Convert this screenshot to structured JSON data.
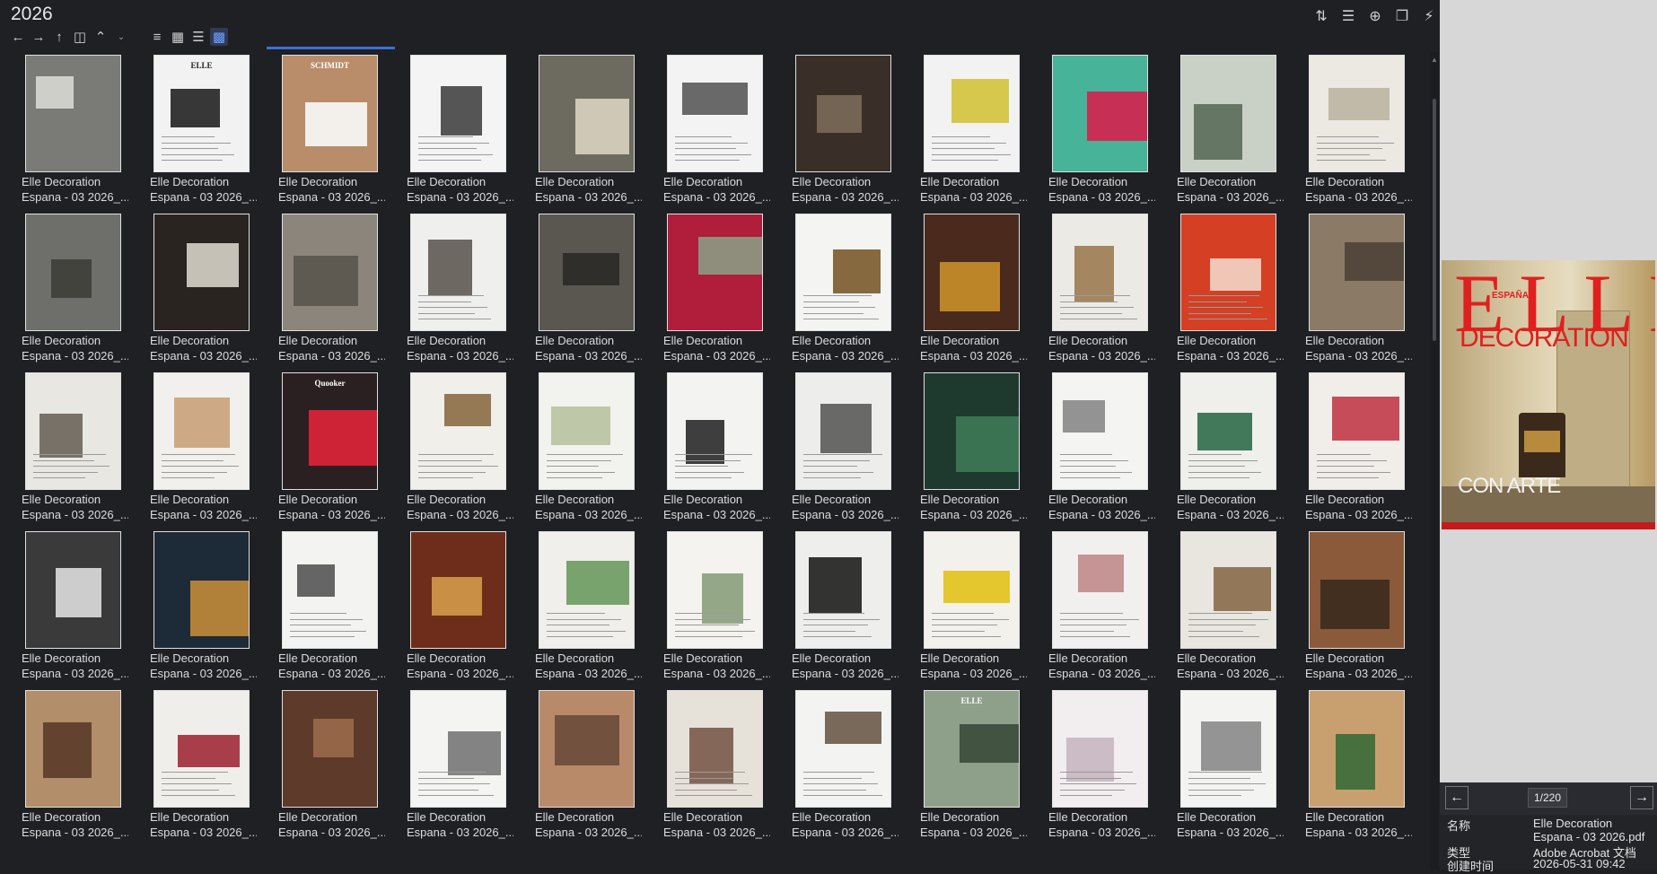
{
  "window": {
    "folder_title": "2026"
  },
  "toolbar": {
    "nav_icons": [
      "back-arrow-icon",
      "forward-arrow-icon",
      "up-arrow-icon",
      "folder-icon",
      "chevron-up-icon",
      "chevron-down-icon"
    ],
    "view_icons": [
      "details-view-icon",
      "list-view-icon",
      "tree-view-icon",
      "thumbnail-view-icon"
    ],
    "active_view": "thumbnail-view-icon",
    "right_icons": [
      "sort-icon",
      "filter-list-icon",
      "add-icon",
      "copy-icon",
      "lightning-icon"
    ]
  },
  "accent_color": "#3b6fd3",
  "files": {
    "line1": "Elle Decoration",
    "line2": "Espana - 03 2026_...",
    "visible_rows": 5,
    "columns": 11,
    "thumbnails": [
      {
        "bg": "#7a7a76",
        "accent": "#d8d8d4",
        "text": ""
      },
      {
        "bg": "#f2f2f2",
        "accent": "#222",
        "text": "ELLE"
      },
      {
        "bg": "#b98d6a",
        "accent": "#fafafa",
        "text": "SCHMIDT"
      },
      {
        "bg": "#f4f4f4",
        "accent": "#444",
        "text": ""
      },
      {
        "bg": "#6d6a60",
        "accent": "#d9d3c1",
        "text": ""
      },
      {
        "bg": "#f3f3f3",
        "accent": "#5a5a5a",
        "text": ""
      },
      {
        "bg": "#3a2f28",
        "accent": "#7a6a58",
        "text": ""
      },
      {
        "bg": "#f2f2f2",
        "accent": "#d2c33a",
        "text": ""
      },
      {
        "bg": "#47b49a",
        "accent": "#d6204c",
        "text": ""
      },
      {
        "bg": "#c9d0c6",
        "accent": "#5b6b5a",
        "text": ""
      },
      {
        "bg": "#ece9e2",
        "accent": "#bcb5a3",
        "text": ""
      },
      {
        "bg": "#6e6e6a",
        "accent": "#3e3e3a",
        "text": ""
      },
      {
        "bg": "#2a2420",
        "accent": "#d7d3c8",
        "text": ""
      },
      {
        "bg": "#8b857b",
        "accent": "#5a554d",
        "text": ""
      },
      {
        "bg": "#efefed",
        "accent": "#5e5a52",
        "text": ""
      },
      {
        "bg": "#5a5750",
        "accent": "#2b2a27",
        "text": ""
      },
      {
        "bg": "#b01e3b",
        "accent": "#8c9a84",
        "text": ""
      },
      {
        "bg": "#f4f4f2",
        "accent": "#7a5a2a",
        "text": ""
      },
      {
        "bg": "#4a2a1c",
        "accent": "#c9902a",
        "text": ""
      },
      {
        "bg": "#eceae5",
        "accent": "#9c7b52",
        "text": ""
      },
      {
        "bg": "#d53f24",
        "accent": "#f3d6c8",
        "text": ""
      },
      {
        "bg": "#8b7a66",
        "accent": "#4c4236",
        "text": ""
      },
      {
        "bg": "#e9e7e2",
        "accent": "#6a645a",
        "text": ""
      },
      {
        "bg": "#f2f0ec",
        "accent": "#c9a27a",
        "text": ""
      },
      {
        "bg": "#2a2022",
        "accent": "#e0243a",
        "text": "Quooker"
      },
      {
        "bg": "#f1efea",
        "accent": "#8b6a44",
        "text": ""
      },
      {
        "bg": "#f2f2ef",
        "accent": "#b8c3a0",
        "text": ""
      },
      {
        "bg": "#f3f3f1",
        "accent": "#2a2a2a",
        "text": ""
      },
      {
        "bg": "#ededeb",
        "accent": "#5a5a5a",
        "text": ""
      },
      {
        "bg": "#1e3a2e",
        "accent": "#3c7a56",
        "text": ""
      },
      {
        "bg": "#f4f4f2",
        "accent": "#888",
        "text": ""
      },
      {
        "bg": "#efefec",
        "accent": "#2d6b4a",
        "text": ""
      },
      {
        "bg": "#f1eeea",
        "accent": "#c23a4a",
        "text": ""
      },
      {
        "bg": "#3a3a3a",
        "accent": "#dedede",
        "text": ""
      },
      {
        "bg": "#1d2a38",
        "accent": "#c28a3a",
        "text": ""
      },
      {
        "bg": "#f3f3f1",
        "accent": "#555",
        "text": ""
      },
      {
        "bg": "#6e2d1a",
        "accent": "#d19a4a",
        "text": ""
      },
      {
        "bg": "#f0efeb",
        "accent": "#6a9a5e",
        "text": ""
      },
      {
        "bg": "#f5f3ef",
        "accent": "#8aa07c",
        "text": ""
      },
      {
        "bg": "#eeeeec",
        "accent": "#1e1e1e",
        "text": ""
      },
      {
        "bg": "#f3f1ec",
        "accent": "#e2c21a",
        "text": ""
      },
      {
        "bg": "#f2f0ee",
        "accent": "#c08a8a",
        "text": ""
      },
      {
        "bg": "#e9e6e0",
        "accent": "#8a6a4a",
        "text": ""
      },
      {
        "bg": "#8a5a3a",
        "accent": "#3a2a1e",
        "text": ""
      },
      {
        "bg": "#b28e6a",
        "accent": "#5a3a2a",
        "text": ""
      },
      {
        "bg": "#f0eeea",
        "accent": "#a12a3a",
        "text": ""
      },
      {
        "bg": "#5e3a2a",
        "accent": "#9a6a4a",
        "text": ""
      },
      {
        "bg": "#f4f4f2",
        "accent": "#777",
        "text": ""
      },
      {
        "bg": "#b88a6a",
        "accent": "#6a4a3a",
        "text": ""
      },
      {
        "bg": "#e6e2da",
        "accent": "#7a5a4a",
        "text": ""
      },
      {
        "bg": "#f3f3f1",
        "accent": "#6a5a4a",
        "text": ""
      },
      {
        "bg": "#8fa08a",
        "accent": "#3a4a3a",
        "text": "ELLE"
      },
      {
        "bg": "#f2eef0",
        "accent": "#c7b6c0",
        "text": ""
      },
      {
        "bg": "#f3f3f1",
        "accent": "#8a8a8a",
        "text": ""
      },
      {
        "bg": "#c8a070",
        "accent": "#3a6a3a",
        "text": ""
      }
    ]
  },
  "preview": {
    "cover": {
      "logo": "ELLE",
      "edition": "ESPAÑA",
      "subtitle": "DECORATION",
      "tagline": "CON ARTE"
    },
    "pager": {
      "count": "1/220"
    },
    "properties": [
      {
        "key": "名称",
        "value": "Elle Decoration"
      },
      {
        "key": "",
        "value": "Espana - 03 2026.pdf"
      },
      {
        "key": "类型",
        "value": "Adobe Acrobat 文档"
      },
      {
        "key": "创建时间",
        "value": "2026-05-31 09:42"
      }
    ]
  }
}
